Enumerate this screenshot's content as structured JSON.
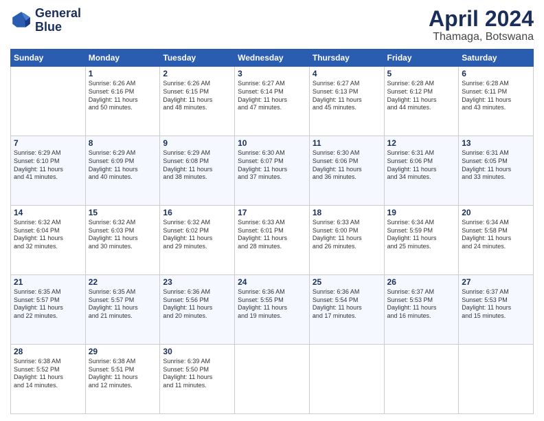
{
  "logo": {
    "line1": "General",
    "line2": "Blue"
  },
  "title": "April 2024",
  "location": "Thamaga, Botswana",
  "weekdays": [
    "Sunday",
    "Monday",
    "Tuesday",
    "Wednesday",
    "Thursday",
    "Friday",
    "Saturday"
  ],
  "weeks": [
    [
      {
        "day": "",
        "info": ""
      },
      {
        "day": "1",
        "info": "Sunrise: 6:26 AM\nSunset: 6:16 PM\nDaylight: 11 hours\nand 50 minutes."
      },
      {
        "day": "2",
        "info": "Sunrise: 6:26 AM\nSunset: 6:15 PM\nDaylight: 11 hours\nand 48 minutes."
      },
      {
        "day": "3",
        "info": "Sunrise: 6:27 AM\nSunset: 6:14 PM\nDaylight: 11 hours\nand 47 minutes."
      },
      {
        "day": "4",
        "info": "Sunrise: 6:27 AM\nSunset: 6:13 PM\nDaylight: 11 hours\nand 45 minutes."
      },
      {
        "day": "5",
        "info": "Sunrise: 6:28 AM\nSunset: 6:12 PM\nDaylight: 11 hours\nand 44 minutes."
      },
      {
        "day": "6",
        "info": "Sunrise: 6:28 AM\nSunset: 6:11 PM\nDaylight: 11 hours\nand 43 minutes."
      }
    ],
    [
      {
        "day": "7",
        "info": "Sunrise: 6:29 AM\nSunset: 6:10 PM\nDaylight: 11 hours\nand 41 minutes."
      },
      {
        "day": "8",
        "info": "Sunrise: 6:29 AM\nSunset: 6:09 PM\nDaylight: 11 hours\nand 40 minutes."
      },
      {
        "day": "9",
        "info": "Sunrise: 6:29 AM\nSunset: 6:08 PM\nDaylight: 11 hours\nand 38 minutes."
      },
      {
        "day": "10",
        "info": "Sunrise: 6:30 AM\nSunset: 6:07 PM\nDaylight: 11 hours\nand 37 minutes."
      },
      {
        "day": "11",
        "info": "Sunrise: 6:30 AM\nSunset: 6:06 PM\nDaylight: 11 hours\nand 36 minutes."
      },
      {
        "day": "12",
        "info": "Sunrise: 6:31 AM\nSunset: 6:06 PM\nDaylight: 11 hours\nand 34 minutes."
      },
      {
        "day": "13",
        "info": "Sunrise: 6:31 AM\nSunset: 6:05 PM\nDaylight: 11 hours\nand 33 minutes."
      }
    ],
    [
      {
        "day": "14",
        "info": "Sunrise: 6:32 AM\nSunset: 6:04 PM\nDaylight: 11 hours\nand 32 minutes."
      },
      {
        "day": "15",
        "info": "Sunrise: 6:32 AM\nSunset: 6:03 PM\nDaylight: 11 hours\nand 30 minutes."
      },
      {
        "day": "16",
        "info": "Sunrise: 6:32 AM\nSunset: 6:02 PM\nDaylight: 11 hours\nand 29 minutes."
      },
      {
        "day": "17",
        "info": "Sunrise: 6:33 AM\nSunset: 6:01 PM\nDaylight: 11 hours\nand 28 minutes."
      },
      {
        "day": "18",
        "info": "Sunrise: 6:33 AM\nSunset: 6:00 PM\nDaylight: 11 hours\nand 26 minutes."
      },
      {
        "day": "19",
        "info": "Sunrise: 6:34 AM\nSunset: 5:59 PM\nDaylight: 11 hours\nand 25 minutes."
      },
      {
        "day": "20",
        "info": "Sunrise: 6:34 AM\nSunset: 5:58 PM\nDaylight: 11 hours\nand 24 minutes."
      }
    ],
    [
      {
        "day": "21",
        "info": "Sunrise: 6:35 AM\nSunset: 5:57 PM\nDaylight: 11 hours\nand 22 minutes."
      },
      {
        "day": "22",
        "info": "Sunrise: 6:35 AM\nSunset: 5:57 PM\nDaylight: 11 hours\nand 21 minutes."
      },
      {
        "day": "23",
        "info": "Sunrise: 6:36 AM\nSunset: 5:56 PM\nDaylight: 11 hours\nand 20 minutes."
      },
      {
        "day": "24",
        "info": "Sunrise: 6:36 AM\nSunset: 5:55 PM\nDaylight: 11 hours\nand 19 minutes."
      },
      {
        "day": "25",
        "info": "Sunrise: 6:36 AM\nSunset: 5:54 PM\nDaylight: 11 hours\nand 17 minutes."
      },
      {
        "day": "26",
        "info": "Sunrise: 6:37 AM\nSunset: 5:53 PM\nDaylight: 11 hours\nand 16 minutes."
      },
      {
        "day": "27",
        "info": "Sunrise: 6:37 AM\nSunset: 5:53 PM\nDaylight: 11 hours\nand 15 minutes."
      }
    ],
    [
      {
        "day": "28",
        "info": "Sunrise: 6:38 AM\nSunset: 5:52 PM\nDaylight: 11 hours\nand 14 minutes."
      },
      {
        "day": "29",
        "info": "Sunrise: 6:38 AM\nSunset: 5:51 PM\nDaylight: 11 hours\nand 12 minutes."
      },
      {
        "day": "30",
        "info": "Sunrise: 6:39 AM\nSunset: 5:50 PM\nDaylight: 11 hours\nand 11 minutes."
      },
      {
        "day": "",
        "info": ""
      },
      {
        "day": "",
        "info": ""
      },
      {
        "day": "",
        "info": ""
      },
      {
        "day": "",
        "info": ""
      }
    ]
  ]
}
